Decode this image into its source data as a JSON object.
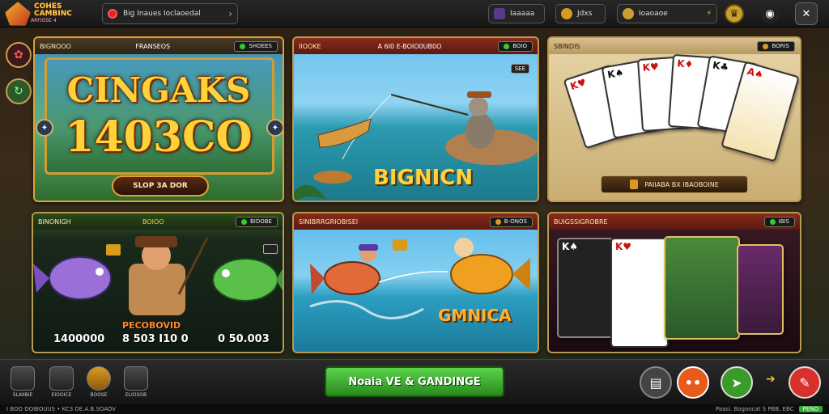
{
  "app": {
    "logo_line1": "COHES CAMBINC",
    "logo_line2": "ARFIOSE 4"
  },
  "topbar": {
    "search_text": "Big Inaues Ioclaoedal",
    "pill1": "Iaaaaa",
    "pill2": "Jdxs",
    "pill3": "Ioaoaoe"
  },
  "cards": [
    {
      "head": "BIGNOOO",
      "mid": "FRANSEOS",
      "badge": "SHOEES",
      "title1": "CINGAKS",
      "title2": "1403CO",
      "button": "SLOP 3A DOR"
    },
    {
      "head": "IIOOKE",
      "mid": "A 6I0 E-BOIO0UB0O",
      "badge": "BOIO",
      "corner": "SEE",
      "label": "BIGNICN"
    },
    {
      "head": "SBINDIS",
      "badge": "BORIS",
      "button": "PAIIABA BX IBAOBOINE"
    },
    {
      "head": "BINONIGH",
      "mid": "BOIOO",
      "badge": "BIDOBE",
      "label": "PECOBOVID",
      "val1": "1400000",
      "val2": "8 503 I10 0",
      "val3": "0 50.003"
    },
    {
      "head": "SINIBRRGRIOBISEI",
      "badge": "B-ONOS",
      "label": "GMNICA"
    },
    {
      "head": "BUIGSSIGROBRE",
      "badge": "IBIS"
    }
  ],
  "bottom": {
    "nav": [
      "SLAIIBIE",
      "EIOOICE",
      "BOOSE",
      "ELIOSOB"
    ],
    "play": "Noaia VE & GANDINGE"
  },
  "status": {
    "left": "I BOO DOIBOUUS  •  KC3  DE.A.B.SOAOV",
    "right": "Paasi. Bogoocat S  PBB, EBC",
    "badge": "PENO"
  },
  "colors": {
    "accent": "#e0a030",
    "play": "#3aa82a",
    "gold": "#ffd23a"
  }
}
